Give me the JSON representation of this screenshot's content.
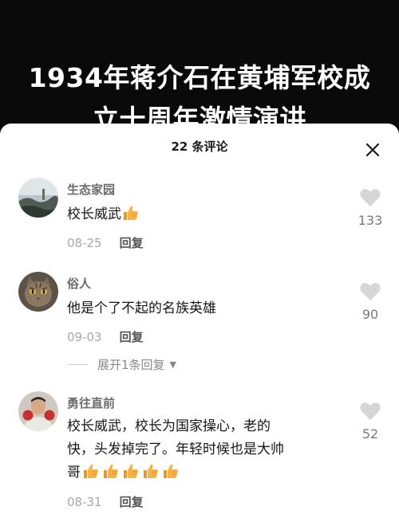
{
  "video": {
    "title_line1": "1934年蒋介石在黄埔军校成",
    "title_line2": "立十周年激情演讲"
  },
  "sheet": {
    "title": "22 条评论",
    "close_icon": "close-icon"
  },
  "comments": [
    {
      "author": "生态家园",
      "text": "校长威武",
      "emoji": [
        "thumbs-up"
      ],
      "date": "08-25",
      "reply_label": "回复",
      "likes": "133"
    },
    {
      "author": "俗人",
      "text": "他是个了不起的名族英雄",
      "emoji": [],
      "date": "09-03",
      "reply_label": "回复",
      "likes": "90",
      "expand_label": "展开1条回复"
    },
    {
      "author": "勇往直前",
      "text_line1": "校长威武，校长为国家操心，老的",
      "text_line2": "快，头发掉完了。年轻时候也是大帅",
      "text_line3": "哥",
      "emoji": [
        "thumbs-up",
        "thumbs-up",
        "thumbs-up",
        "thumbs-up",
        "thumbs-up"
      ],
      "date": "08-31",
      "reply_label": "回复",
      "likes": "52"
    }
  ],
  "colors": {
    "sheet_bg": "#ffffff",
    "video_bg": "#0a0a0a",
    "heart_gray": "#d6d6d6",
    "emoji_thumb": "#f5b344"
  }
}
